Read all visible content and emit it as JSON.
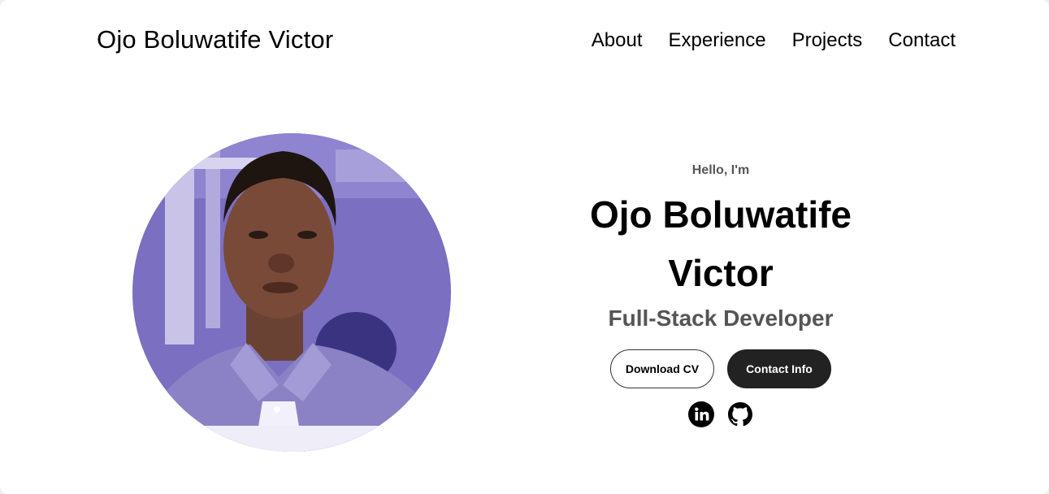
{
  "header": {
    "logo": "Ojo Boluwatife Victor",
    "nav": [
      "About",
      "Experience",
      "Projects",
      "Contact"
    ]
  },
  "profile": {
    "photo_icon": "profile-photo"
  },
  "hero": {
    "greeting": "Hello, I'm",
    "name": "Ojo Boluwatife Victor",
    "title": "Full-Stack Developer",
    "buttons": {
      "download_cv": "Download CV",
      "contact_info": "Contact Info"
    },
    "socials": [
      {
        "icon": "linkedin-icon"
      },
      {
        "icon": "github-icon"
      }
    ]
  },
  "colors": {
    "background": "#ffffff",
    "text": "#000000",
    "muted": "#555555",
    "button_dark": "#222222"
  }
}
